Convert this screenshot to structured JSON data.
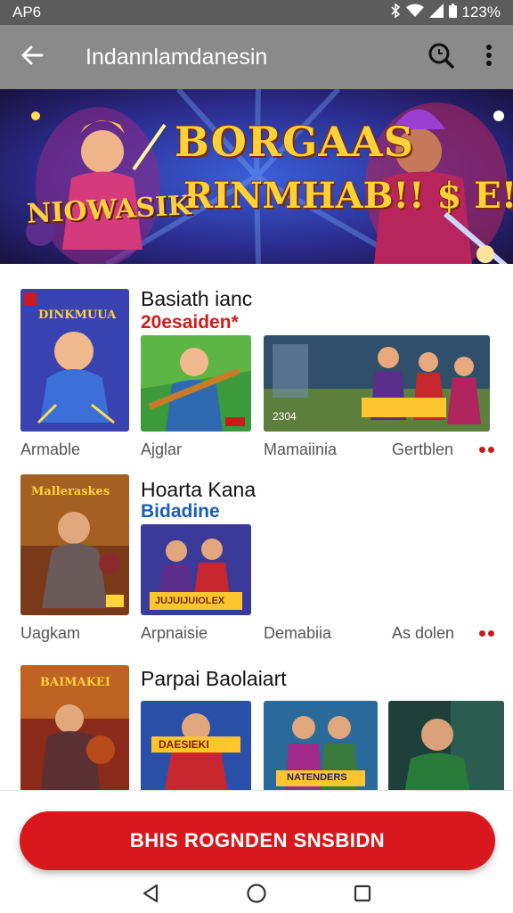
{
  "status_bar": {
    "left": "AP6",
    "right_icons": [
      "bluetooth-icon",
      "wifi-icon",
      "signal-icon",
      "battery-icon"
    ],
    "battery": "123%"
  },
  "app_bar": {
    "title": "Indannlamdanesin",
    "back_icon": "arrow-left-icon",
    "search_icon": "search-icon",
    "menu_icon": "more-vert-icon"
  },
  "banner": {
    "headline1": "BORGAAS",
    "headline2": "RINMHAB!! $ E!",
    "logo": "NIOWASIK"
  },
  "sections": [
    {
      "title": "Basiath ianc",
      "subtitle": "20esaiden*",
      "subtitle_color": "#d21a1a",
      "cover_text": "DINKMUUA",
      "tile_texts": [
        "",
        "2304"
      ],
      "labels": [
        "Armable",
        "Ajglar",
        "Mamaiinia",
        "Gertblen"
      ]
    },
    {
      "title": "Ноarta Kana",
      "subtitle": "Bidadine",
      "subtitle_color": "#1b5db8",
      "cover_text": "Malleraskes",
      "tile_texts": [
        "JUJUIJUIOLEX"
      ],
      "labels": [
        "Uagkam",
        "Arpnaisie",
        "Demabiia",
        "As dolen"
      ]
    },
    {
      "title": "Parpai Baolaiart",
      "cover_text": "BAIMAKEI",
      "tile_texts": [
        "DAESIEKI",
        "NATENDERS"
      ]
    }
  ],
  "cta": {
    "label": "BHIS ROGNDEN SNSBIDN"
  },
  "nav": {
    "back": "nav-back-icon",
    "home": "nav-home-icon",
    "recents": "nav-recents-icon"
  },
  "colors": {
    "accent": "#d9181d",
    "app_bar": "#8a8a8a",
    "status_bar": "#5c5c5c"
  }
}
